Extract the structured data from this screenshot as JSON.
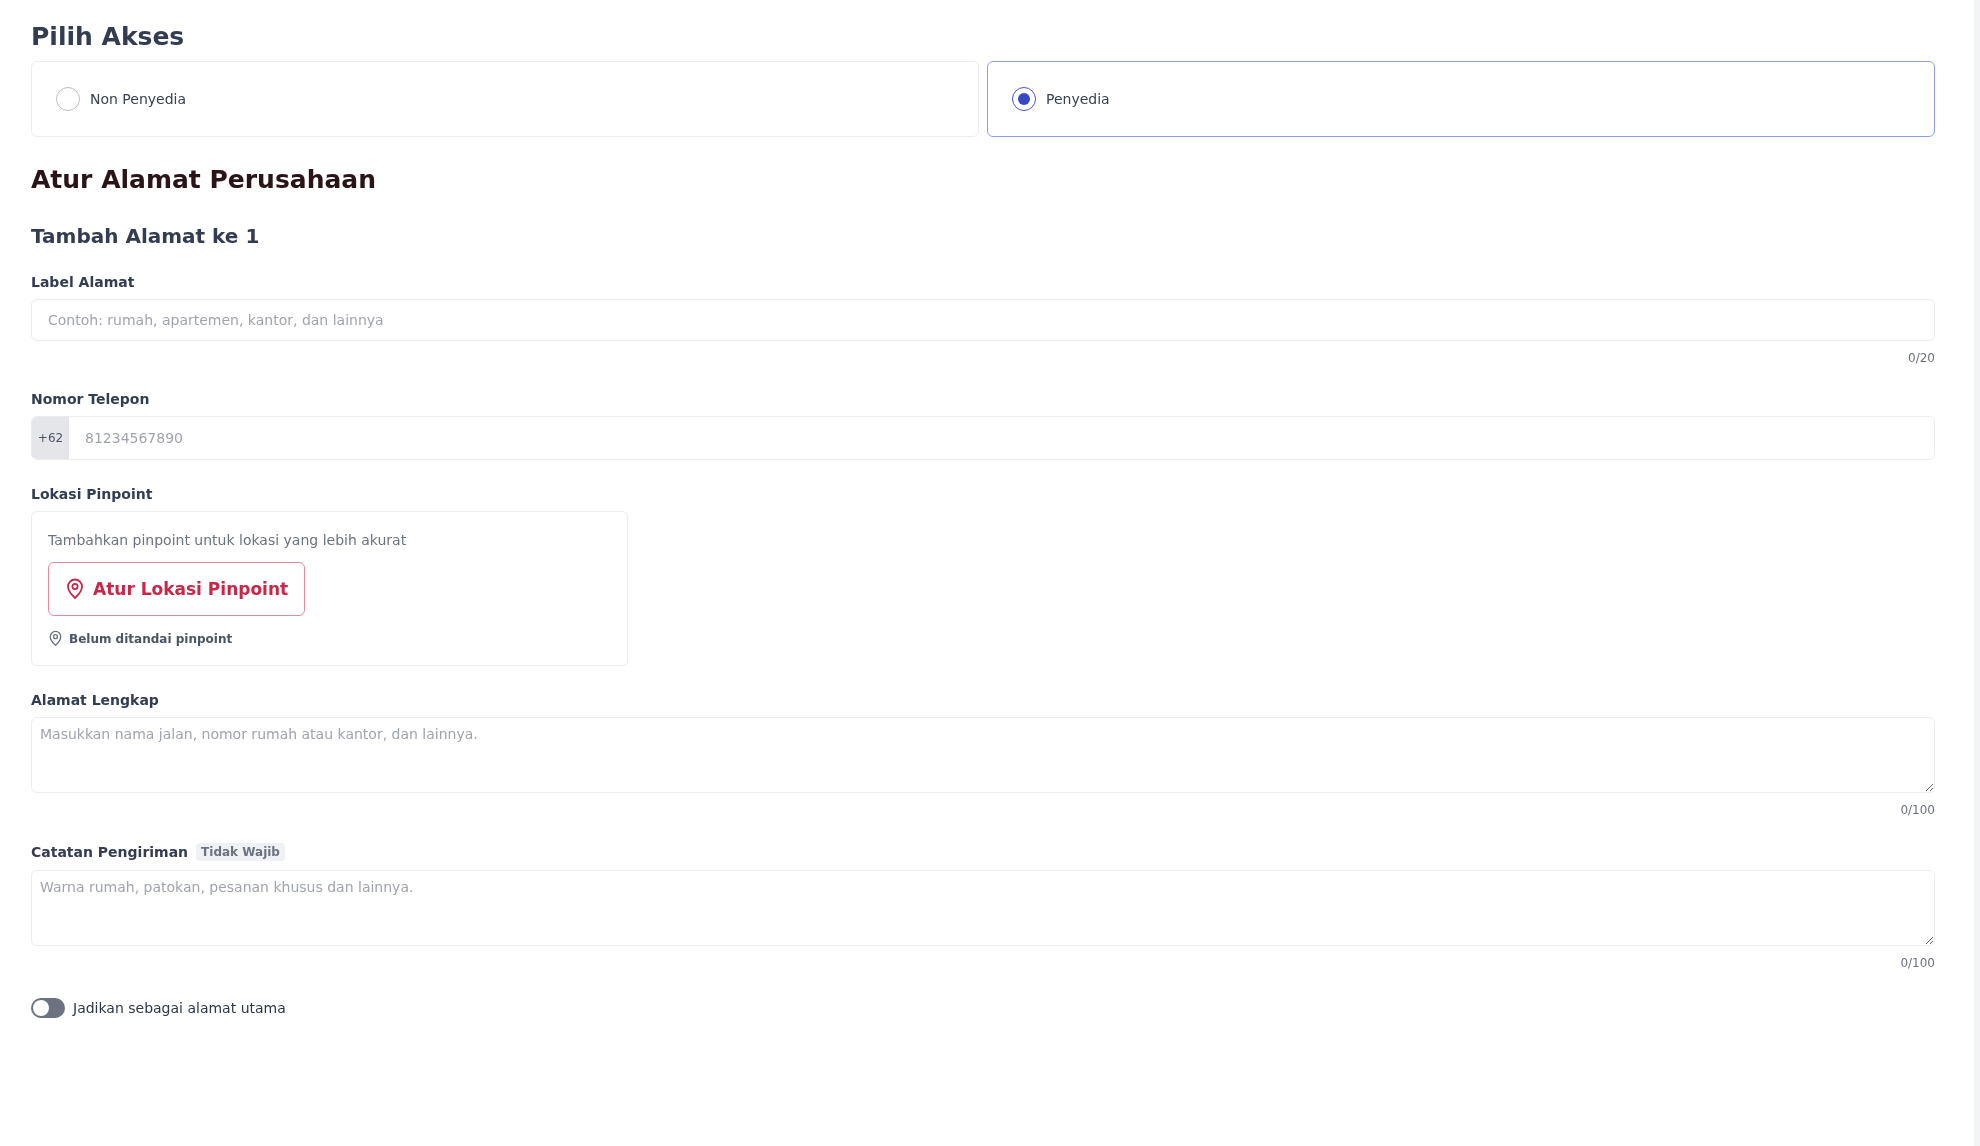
{
  "access": {
    "title": "Pilih Akses",
    "options": [
      {
        "label": "Non Penyedia",
        "selected": false
      },
      {
        "label": "Penyedia",
        "selected": true
      }
    ]
  },
  "address": {
    "title": "Atur Alamat Perusahaan",
    "subtitle": "Tambah Alamat ke 1",
    "fields": [
      {
        "kind": "text",
        "label": "Label Alamat",
        "placeholder": "Contoh: rumah, apartemen, kantor, dan lainnya",
        "counter": "0/20"
      },
      {
        "kind": "phone",
        "label": "Nomor Telepon",
        "prefix": "+62",
        "placeholder": "81234567890"
      },
      {
        "kind": "pinpoint",
        "label": "Lokasi Pinpoint",
        "hint": "Tambahkan pinpoint untuk lokasi yang lebih akurat",
        "button": "Atur Lokasi Pinpoint",
        "status": "Belum ditandai pinpoint"
      },
      {
        "kind": "textarea",
        "label": "Alamat Lengkap",
        "placeholder": "Masukkan nama jalan, nomor rumah atau kantor, dan lainnya.",
        "counter": "0/100"
      },
      {
        "kind": "textarea",
        "label": "Catatan Pengiriman",
        "tag": "Tidak Wajib",
        "placeholder": "Warna rumah, patokan, pesanan khusus dan lainnya.",
        "counter": "0/100"
      }
    ],
    "primary_toggle": {
      "label": "Jadikan sebagai alamat utama",
      "on": false
    }
  }
}
